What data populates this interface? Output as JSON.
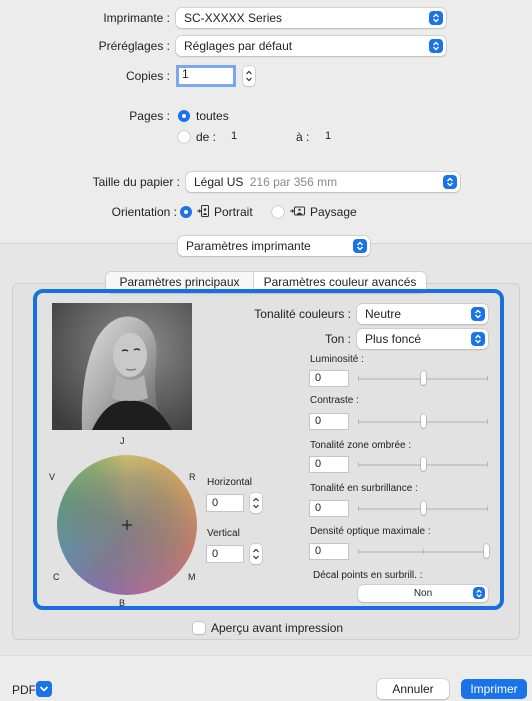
{
  "printer": {
    "label": "Imprimante :",
    "value": "SC-XXXXX Series"
  },
  "presets": {
    "label": "Préréglages :",
    "value": "Réglages par défaut"
  },
  "copies": {
    "label": "Copies :",
    "value": "1"
  },
  "pages": {
    "label": "Pages :",
    "all_label": "toutes",
    "from_label": "de :",
    "from_value": "1",
    "to_label": "à :",
    "to_value": "1"
  },
  "paper_size": {
    "label": "Taille du papier :",
    "value": "Légal US",
    "detail": "216 par 356 mm"
  },
  "orientation": {
    "label": "Orientation :",
    "portrait": "Portrait",
    "landscape": "Paysage"
  },
  "section_popup": {
    "value": "Paramètres imprimante"
  },
  "tabs": [
    {
      "label": "Paramètres principaux",
      "active": false
    },
    {
      "label": "Paramètres couleur avancés",
      "active": true
    }
  ],
  "color_panel": {
    "tone_color_label": "Tonalité couleurs :",
    "tone_color_value": "Neutre",
    "tone_label": "Ton :",
    "tone_value": "Plus foncé",
    "wheel_labels": {
      "top": "J",
      "left": "V",
      "right": "R",
      "bottom_left": "C",
      "bottom_right": "M",
      "bottom": "B"
    },
    "horizontal_label": "Horizontal",
    "horizontal_value": "0",
    "vertical_label": "Vertical",
    "vertical_value": "0",
    "sliders": [
      {
        "label": "Luminosité :",
        "value": "0",
        "position": 0.5
      },
      {
        "label": "Contraste :",
        "value": "0",
        "position": 0.5
      },
      {
        "label": "Tonalité zone ombrée :",
        "value": "0",
        "position": 0.5
      },
      {
        "label": "Tonalité en surbrillance :",
        "value": "0",
        "position": 0.5
      },
      {
        "label": "Densité optique maximale :",
        "value": "0",
        "position": 1.0
      }
    ],
    "highlight_dots_label": "Décal points en surbrill. :",
    "highlight_dots_value": "Non"
  },
  "preview_checkbox": {
    "label": "Aperçu avant impression",
    "checked": false
  },
  "footer": {
    "pdf_label": "PDF",
    "cancel_label": "Annuler",
    "print_label": "Imprimer"
  },
  "colors": {
    "accent": "#1a73e8",
    "highlight_frame": "#1a6fde"
  }
}
